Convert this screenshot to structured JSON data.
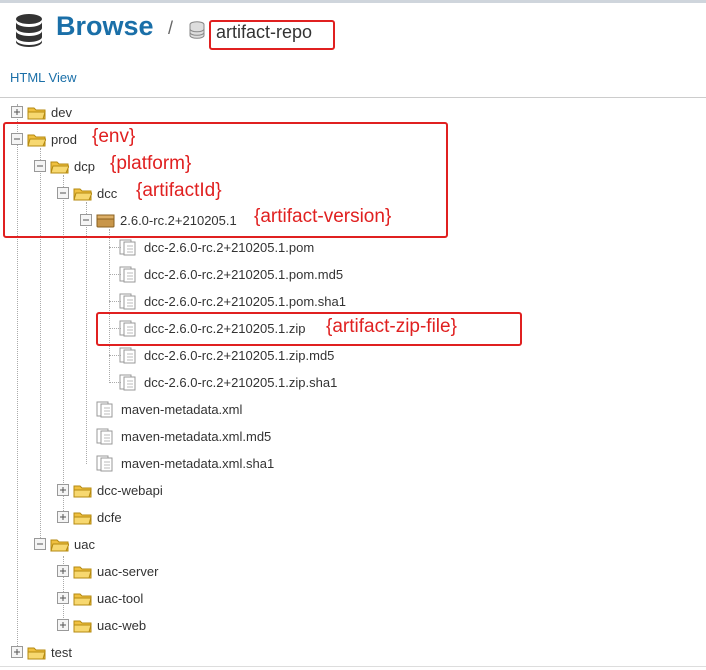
{
  "header": {
    "title": "Browse",
    "separator": "/",
    "repo": "artifact-repo"
  },
  "view_link": "HTML View",
  "tree": {
    "dev": "dev",
    "prod": "prod",
    "dcp": "dcp",
    "dcc": "dcc",
    "version": "2.6.0-rc.2+210205.1",
    "files": [
      "dcc-2.6.0-rc.2+210205.1.pom",
      "dcc-2.6.0-rc.2+210205.1.pom.md5",
      "dcc-2.6.0-rc.2+210205.1.pom.sha1",
      "dcc-2.6.0-rc.2+210205.1.zip",
      "dcc-2.6.0-rc.2+210205.1.zip.md5",
      "dcc-2.6.0-rc.2+210205.1.zip.sha1"
    ],
    "meta_files": [
      "maven-metadata.xml",
      "maven-metadata.xml.md5",
      "maven-metadata.xml.sha1"
    ],
    "dcc_webapi": "dcc-webapi",
    "dcfe": "dcfe",
    "uac": "uac",
    "uac_children": [
      "uac-server",
      "uac-tool",
      "uac-web"
    ],
    "test": "test"
  },
  "annotations": {
    "env": "{env}",
    "platform": "{platform}",
    "artifact_id": "{artifactId}",
    "artifact_version": "{artifact-version}",
    "artifact_zip_file": "{artifact-zip-file}"
  },
  "colors": {
    "brand": "#1a6fa8",
    "annotation": "#e02020",
    "folder": "#f0c040"
  }
}
